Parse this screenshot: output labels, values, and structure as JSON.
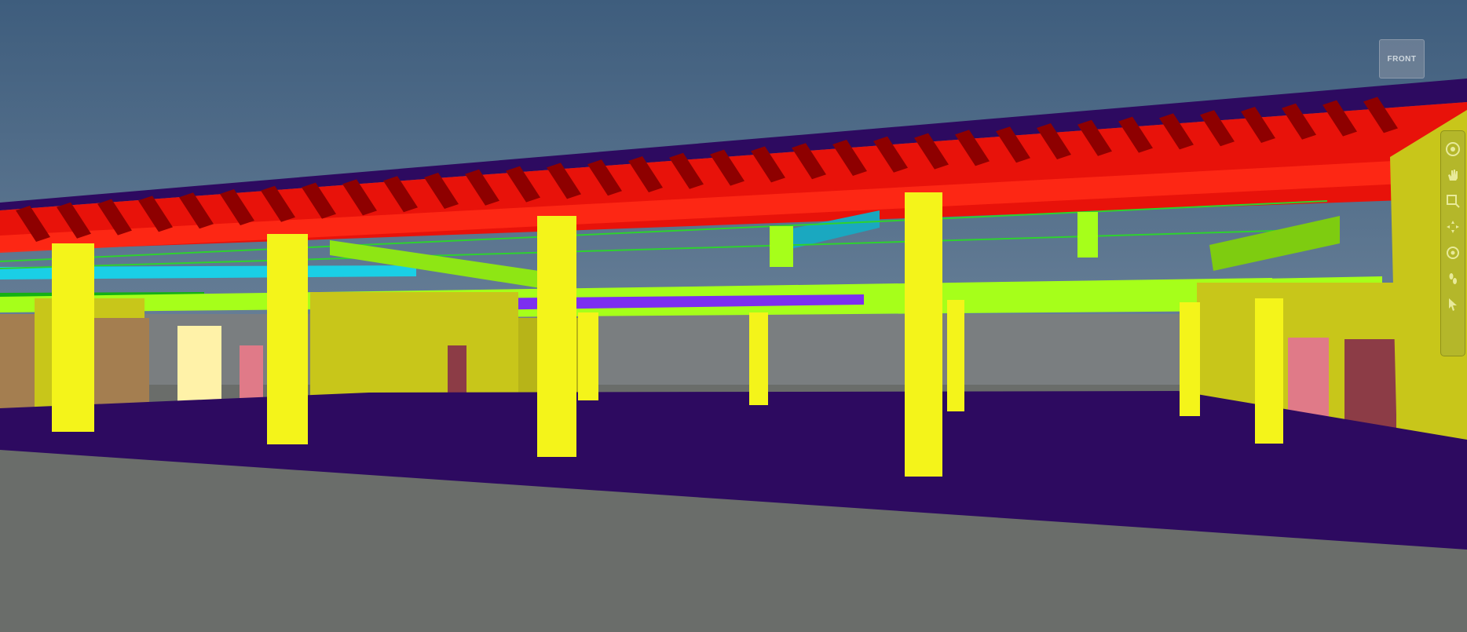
{
  "scene": {
    "sky_color": "#52708f",
    "slab_color": "#2d0a60",
    "floor_color": "#6a6d6a",
    "beam_color": "#ff1a10",
    "joist_color": "#8e0000",
    "column_color": "#f4f41a",
    "duct_color": "#a6ff1a",
    "pipe_color": "#1acfe6",
    "wall_color": "#c8c61a"
  },
  "viewcube": {
    "label": "FRONT"
  },
  "navigation_bar": {
    "tools": [
      {
        "name": "steering-wheel-icon"
      },
      {
        "name": "pan-icon"
      },
      {
        "name": "zoom-window-icon"
      },
      {
        "name": "orbit-icon"
      },
      {
        "name": "look-around-icon"
      },
      {
        "name": "walk-icon"
      },
      {
        "name": "select-pointer-icon"
      }
    ]
  }
}
